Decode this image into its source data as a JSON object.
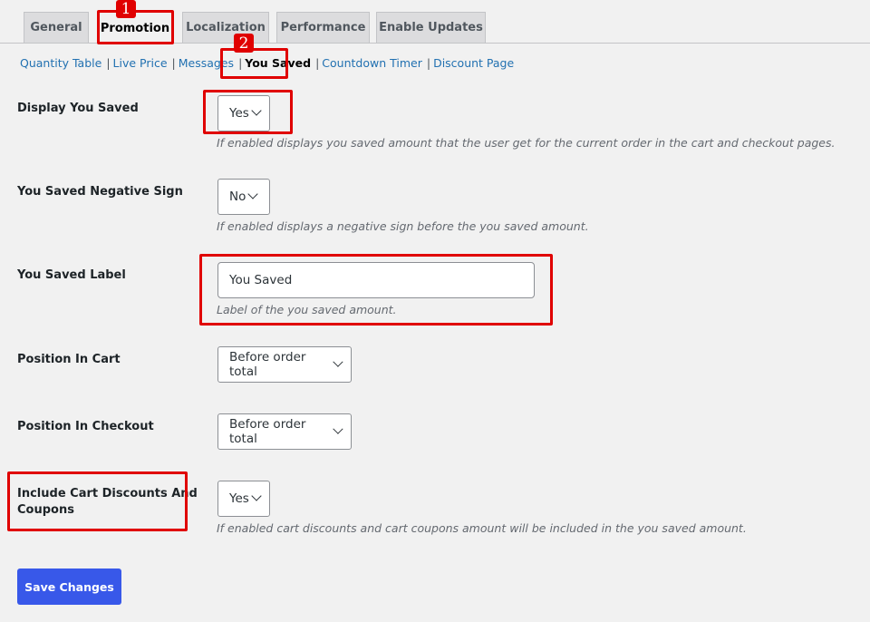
{
  "tabs": [
    {
      "label": "General"
    },
    {
      "label": "Promotion"
    },
    {
      "label": "Localization"
    },
    {
      "label": "Performance"
    },
    {
      "label": "Enable Updates"
    }
  ],
  "subnav": [
    {
      "label": "Quantity Table"
    },
    {
      "label": "Live Price"
    },
    {
      "label": "Messages"
    },
    {
      "label": "You Saved"
    },
    {
      "label": "Countdown Timer"
    },
    {
      "label": "Discount Page"
    }
  ],
  "annotations": {
    "step1": "1",
    "step2": "2"
  },
  "fields": {
    "display_you_saved": {
      "label": "Display You Saved",
      "value": "Yes",
      "description": "If enabled displays you saved amount that the user get for the current order in the cart and checkout pages."
    },
    "negative_sign": {
      "label": "You Saved Negative Sign",
      "value": "No",
      "description": "If enabled displays a negative sign before the you saved amount."
    },
    "you_saved_label": {
      "label": "You Saved Label",
      "value": "You Saved",
      "description": "Label of the you saved amount."
    },
    "position_in_cart": {
      "label": "Position In Cart",
      "value": "Before order total"
    },
    "position_in_checkout": {
      "label": "Position In Checkout",
      "value": "Before order total"
    },
    "include_cart_discounts": {
      "label_line1": "Include Cart Discounts And",
      "label_line2": "Coupons",
      "value": "Yes",
      "description": "If enabled cart discounts and cart coupons amount will be included in the you saved amount."
    }
  },
  "save_button": "Save Changes",
  "colors": {
    "highlight": "#e00000",
    "primary": "#3858e9",
    "link": "#2271b1"
  }
}
